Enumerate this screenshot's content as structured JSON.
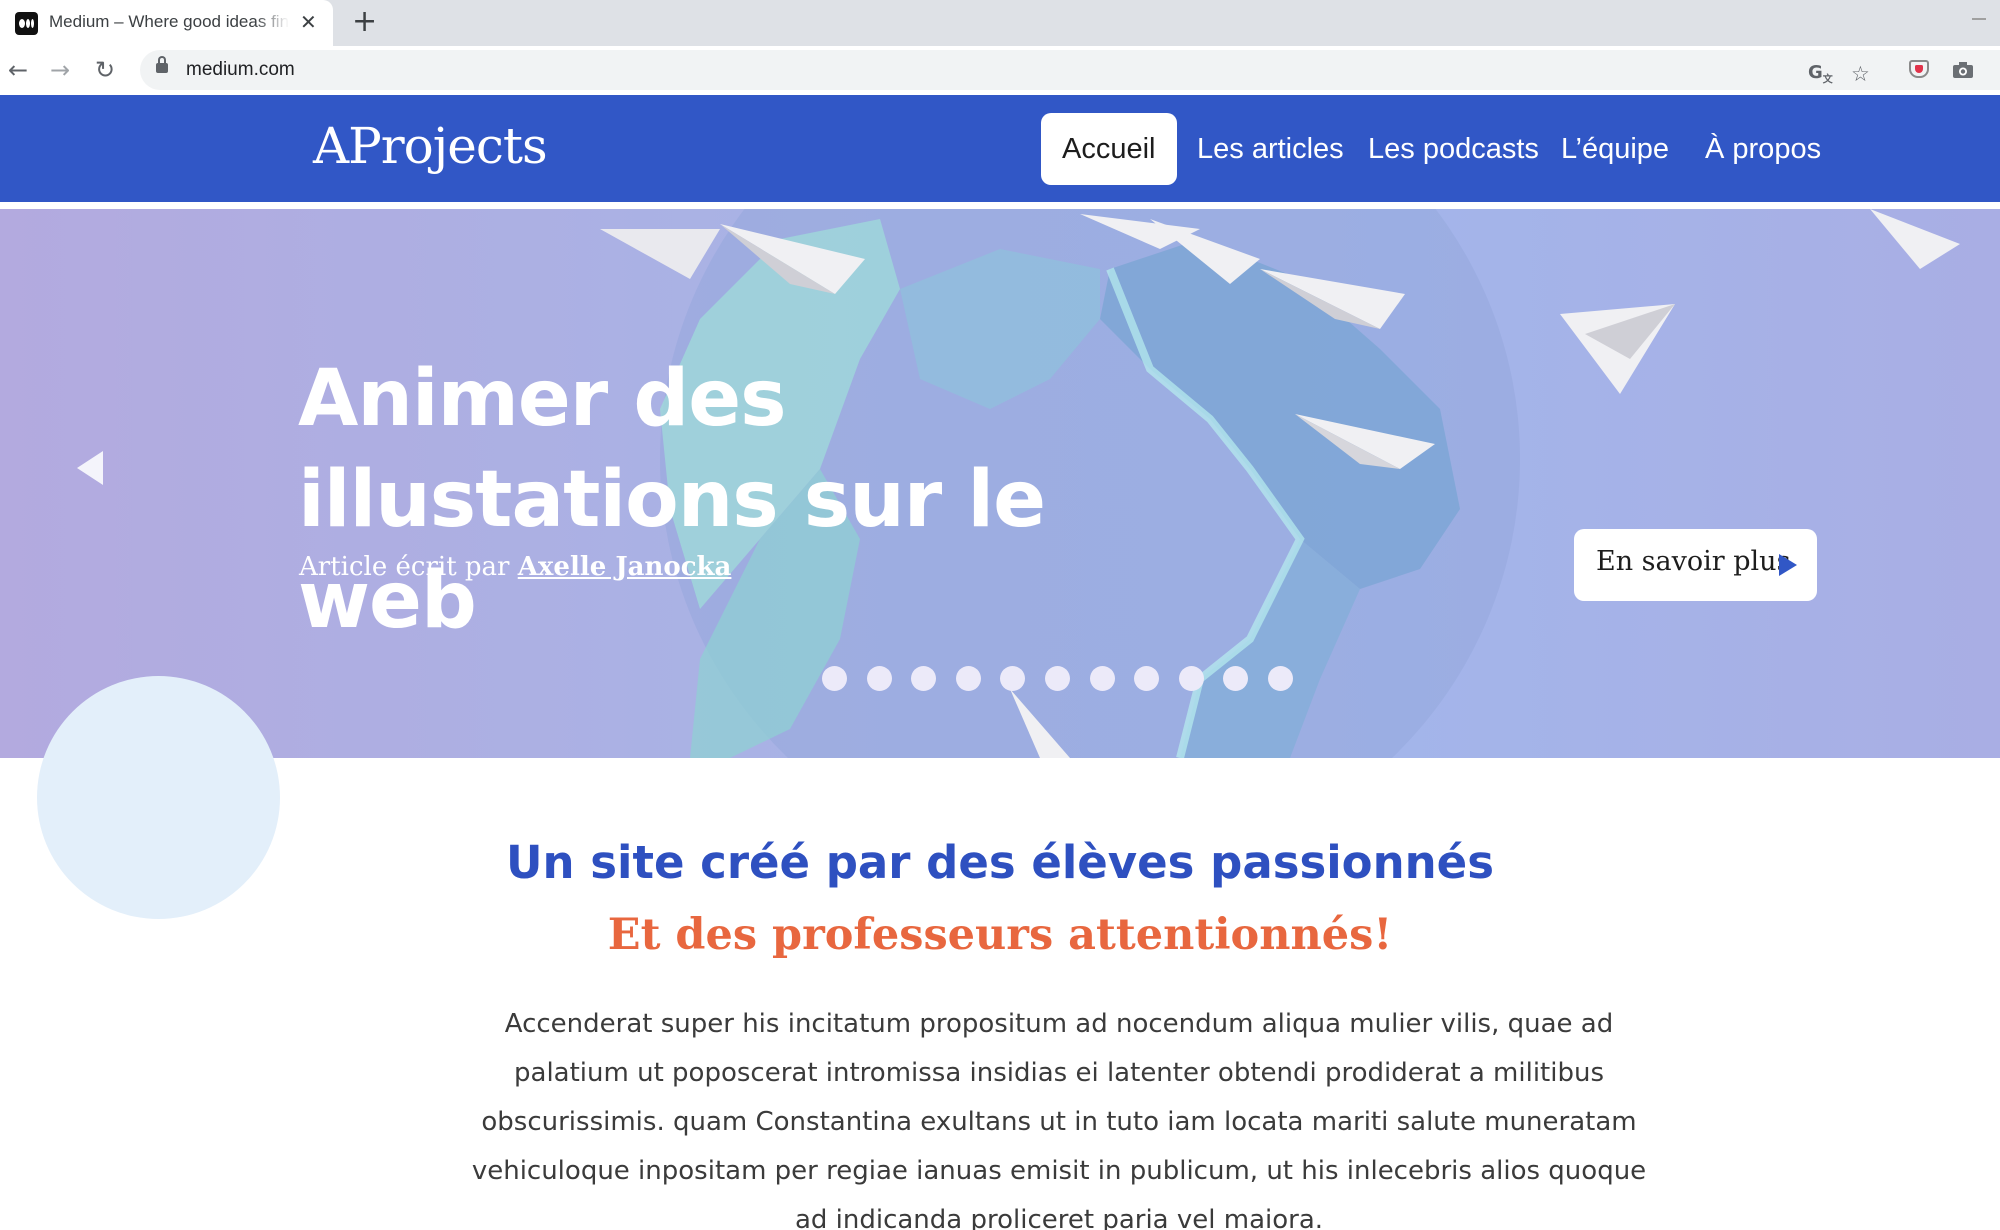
{
  "browser": {
    "tab_title": "Medium – Where good ideas find",
    "tab_favicon": "medium-logo-icon",
    "url": "medium.com",
    "toolbar_icons": [
      "back-icon",
      "forward-icon",
      "reload-icon",
      "lock-icon",
      "translate-icon",
      "star-icon",
      "pocket-icon",
      "camera-icon"
    ]
  },
  "site": {
    "brand": "AProjects",
    "nav": [
      {
        "label": "Accueil",
        "active": true
      },
      {
        "label": "Les articles",
        "active": false
      },
      {
        "label": "Les podcasts",
        "active": false
      },
      {
        "label": "L’équipe",
        "active": false
      },
      {
        "label": "À propos",
        "active": false
      }
    ],
    "colors": {
      "primary": "#3157c6",
      "accent": "#e8673f",
      "title": "#2e50c0"
    }
  },
  "hero": {
    "title_line1": "Animer des",
    "title_line2": "illustations sur le web",
    "byline_prefix": "Article écrit par ",
    "author": "Axelle Janocka",
    "cta_label": "En savoir plus",
    "slide_count": 11,
    "active_slide": 1
  },
  "content": {
    "title": "Un site créé par des élèves passionnés",
    "subtitle": "Et des professeurs attentionnés!",
    "paragraph": "Accenderat super his incitatum propositum ad nocendum aliqua mulier vilis, quae ad palatium ut poposcerat intromissa insidias ei latenter obtendi prodiderat a militibus obscurissimis. quam Constantina exultans ut in tuto iam locata mariti salute muneratam vehiculoque inpositam per regiae ianuas emisit in publicum, ut his inlecebris alios quoque ad indicanda proliceret paria vel maiora."
  }
}
